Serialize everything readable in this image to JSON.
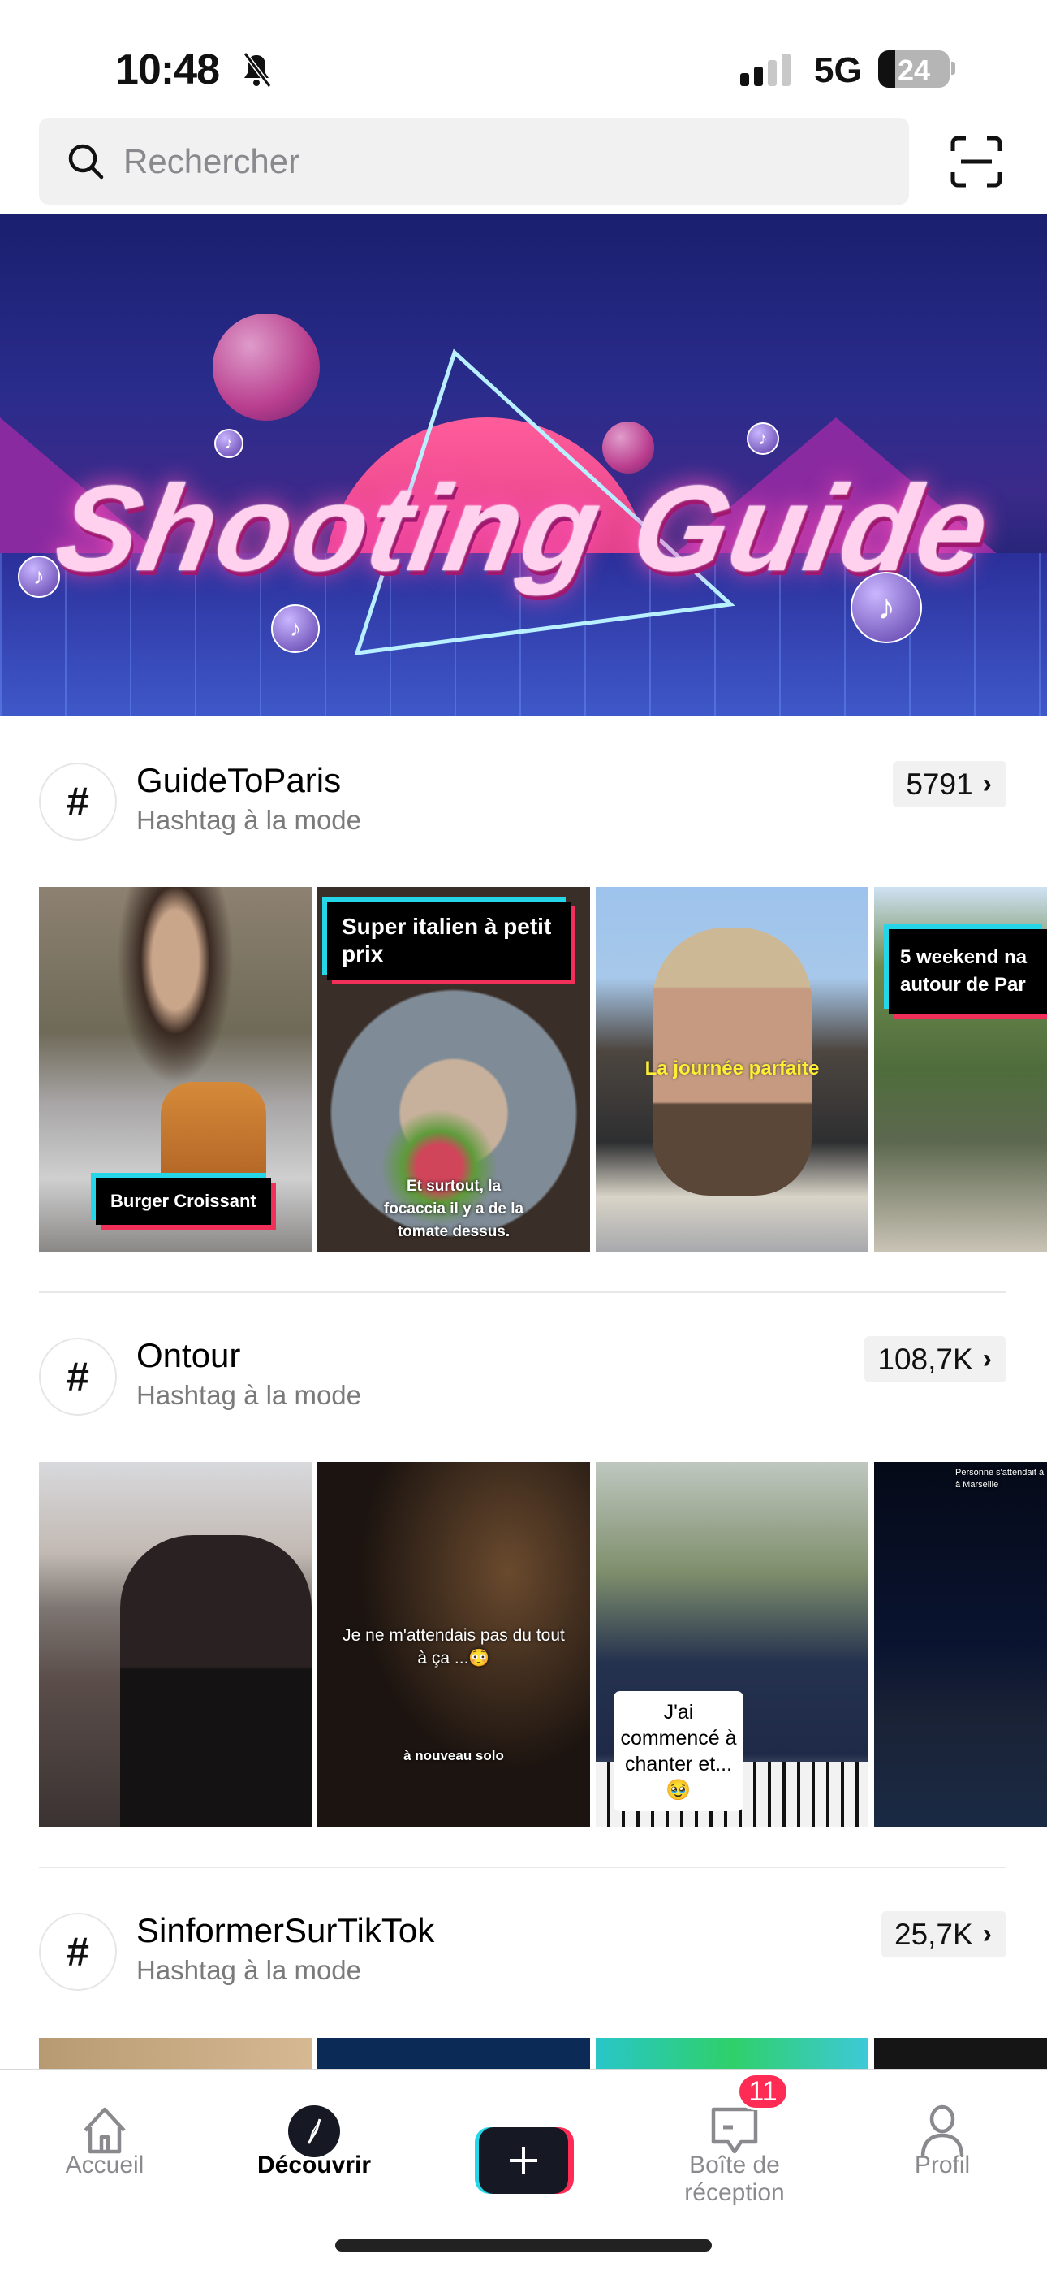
{
  "status_bar": {
    "time": "10:48",
    "network": "5G",
    "battery": "24",
    "battery_level_percent": 24,
    "signal_bars": 2,
    "icons": [
      "bell-slash-icon",
      "signal-icon",
      "battery-icon"
    ]
  },
  "search": {
    "placeholder": "Rechercher",
    "value": "",
    "icon": "search-icon",
    "scan_icon": "scan-icon"
  },
  "banner": {
    "title": "Shooting Guide"
  },
  "sections": [
    {
      "title": "GuideToParis",
      "subtitle": "Hashtag à la mode",
      "count": "5791",
      "thumbs": [
        {
          "caption": "Burger Croissant"
        },
        {
          "caption": "Super italien à petit prix",
          "subtitle": "Et surtout, la focaccia il y a de la tomate dessus."
        },
        {
          "caption": "La journée parfaite"
        },
        {
          "caption": "5 weekend na autour de Par"
        }
      ]
    },
    {
      "title": "Ontour",
      "subtitle": "Hashtag à la mode",
      "count": "108,7K",
      "thumbs": [
        {
          "caption": ""
        },
        {
          "caption": "Je ne m'attendais pas du tout à ça ...😳",
          "subtitle": "à nouveau solo"
        },
        {
          "caption": "J'ai commencé à chanter et... 🥹"
        },
        {
          "caption": "Personne s'attendait à à Marseille"
        }
      ]
    },
    {
      "title": "SinformerSurTikTok",
      "subtitle": "Hashtag à la mode",
      "count": "25,7K"
    }
  ],
  "tabbar": {
    "items": [
      {
        "label": "Accueil",
        "icon": "home-icon"
      },
      {
        "label": "Découvrir",
        "icon": "compass-icon",
        "active": true
      },
      {
        "label": "",
        "icon": "plus-icon"
      },
      {
        "label": "Boîte de réception",
        "icon": "inbox-icon",
        "badge": "11"
      },
      {
        "label": "Profil",
        "icon": "profile-icon"
      }
    ]
  },
  "colors": {
    "accent_red": "#fe2c55",
    "accent_cyan": "#25d5e8",
    "text": "#111111",
    "muted": "#8a8a8e"
  }
}
